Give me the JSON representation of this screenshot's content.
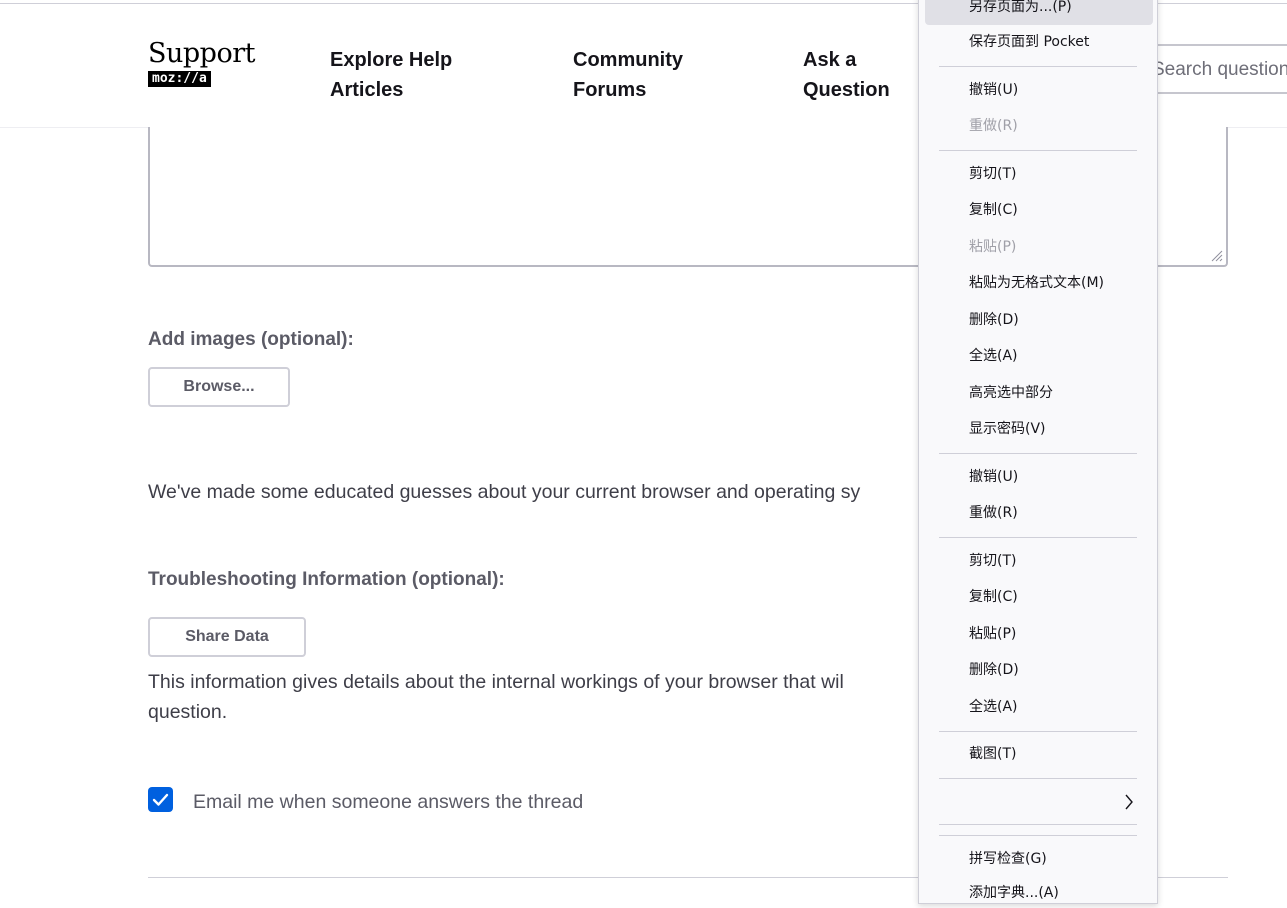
{
  "header": {
    "logo_word": "Support",
    "logo_brand": "moz://a",
    "nav": [
      {
        "line1": "Explore Help",
        "line2": "Articles"
      },
      {
        "line1": "Community",
        "line2": "Forums"
      },
      {
        "line1": "Ask a",
        "line2": "Question"
      }
    ],
    "search_placeholder": "Search questions"
  },
  "form": {
    "add_images_label": "Add images (optional):",
    "browse_button": "Browse...",
    "guess_text": "We've made some educated guesses about your current browser and operating sy",
    "troubleshooting_label": "Troubleshooting Information (optional):",
    "share_data_button": "Share Data",
    "info_line1": "This information gives details about the internal workings of your browser that wil",
    "info_line2": "question.",
    "email_checkbox_label": "Email me when someone answers the thread",
    "email_checked": true
  },
  "context_menu": {
    "items": [
      {
        "label": "另存页面为...(P)",
        "disabled": false,
        "highlighted": true
      },
      {
        "label": "保存页面到 Pocket",
        "disabled": false
      },
      {
        "label": "撤销(U)",
        "disabled": false
      },
      {
        "label": "重做(R)",
        "disabled": true
      },
      {
        "label": "剪切(T)",
        "disabled": false
      },
      {
        "label": "复制(C)",
        "disabled": false
      },
      {
        "label": "粘贴(P)",
        "disabled": true
      },
      {
        "label": "粘贴为无格式文本(M)",
        "disabled": false
      },
      {
        "label": "删除(D)",
        "disabled": false
      },
      {
        "label": "全选(A)",
        "disabled": false
      },
      {
        "label": "高亮选中部分",
        "disabled": false
      },
      {
        "label": "显示密码(V)",
        "disabled": false
      },
      {
        "label": "撤销(U)",
        "disabled": false
      },
      {
        "label": "重做(R)",
        "disabled": false
      },
      {
        "label": "剪切(T)",
        "disabled": false
      },
      {
        "label": "复制(C)",
        "disabled": false
      },
      {
        "label": "粘贴(P)",
        "disabled": false
      },
      {
        "label": "删除(D)",
        "disabled": false
      },
      {
        "label": "全选(A)",
        "disabled": false
      },
      {
        "label": "截图(T)",
        "disabled": false
      },
      {
        "label": "",
        "submenu": true
      },
      {
        "label": "拼写检查(G)",
        "disabled": false
      },
      {
        "label": "添加字典...(A)",
        "disabled": false
      }
    ]
  },
  "colors": {
    "accent": "#0060df",
    "menu_bg": "#f9f9fb",
    "menu_highlight": "#e0e0e6"
  }
}
